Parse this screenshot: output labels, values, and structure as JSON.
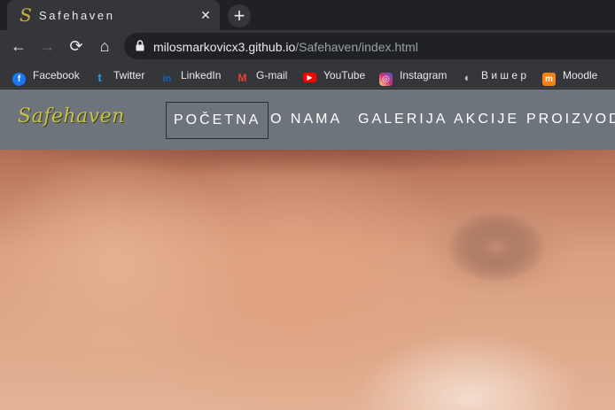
{
  "browser": {
    "tab": {
      "title": "Safehaven",
      "favicon": "S",
      "close_glyph": "✕"
    },
    "new_tab_glyph": "+",
    "toolbar": {
      "back_glyph": "←",
      "forward_glyph": "→",
      "reload_glyph": "⟳",
      "home_glyph": "⌂",
      "url_host": "milosmarkovicx3.github.io",
      "url_path": "/Safehaven/index.html"
    },
    "bookmarks": [
      {
        "label": "Facebook",
        "icon": "facebook-icon",
        "glyph": "f",
        "color": "#1877f2"
      },
      {
        "label": "Twitter",
        "icon": "twitter-icon",
        "glyph": "t",
        "color": "#1da1f2"
      },
      {
        "label": "LinkedIn",
        "icon": "linkedin-icon",
        "glyph": "in",
        "color": "#0a66c2"
      },
      {
        "label": "G-mail",
        "icon": "gmail-icon",
        "glyph": "M",
        "color": "#ea4335"
      },
      {
        "label": "YouTube",
        "icon": "youtube-icon",
        "glyph": "▶",
        "color": "#ff0000"
      },
      {
        "label": "Instagram",
        "icon": "instagram-icon",
        "glyph": "◎",
        "color": "#d6249f"
      },
      {
        "label": "В и ш е р",
        "icon": "globe-icon",
        "glyph": "◐",
        "color": "#9aa0a6"
      },
      {
        "label": "Moodle",
        "icon": "moodle-icon",
        "glyph": "m",
        "color": "#f98012"
      }
    ]
  },
  "site": {
    "logo": "Safehaven",
    "nav": [
      {
        "label": "POČETNA",
        "active": true
      },
      {
        "label": "O NAMA",
        "active": false
      },
      {
        "label": "GALERIJA",
        "active": false
      },
      {
        "label": "AKCIJE",
        "active": false
      },
      {
        "label": "PROIZVODI",
        "active": false
      }
    ]
  },
  "colors": {
    "header_bg": "#6e747b",
    "logo": "#c7c24a",
    "accent_border": "#2a2c30"
  }
}
